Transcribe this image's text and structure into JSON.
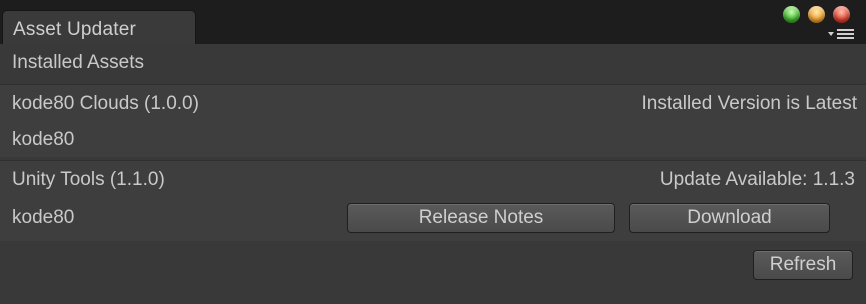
{
  "window": {
    "tab_title": "Asset Updater",
    "controls": [
      "green-dot-icon",
      "yellow-dot-icon",
      "red-dot-icon"
    ],
    "menu_icon": "dropdown-menu-icon"
  },
  "section": {
    "title": "Installed Assets"
  },
  "assets": [
    {
      "name": "kode80 Clouds (1.0.0)",
      "author": "kode80",
      "status": "Installed Version is Latest"
    },
    {
      "name": "Unity Tools (1.1.0)",
      "author": "kode80",
      "status": "Update Available: 1.1.3",
      "actions": {
        "release_notes": "Release Notes",
        "download": "Download"
      }
    }
  ],
  "footer": {
    "refresh": "Refresh"
  }
}
